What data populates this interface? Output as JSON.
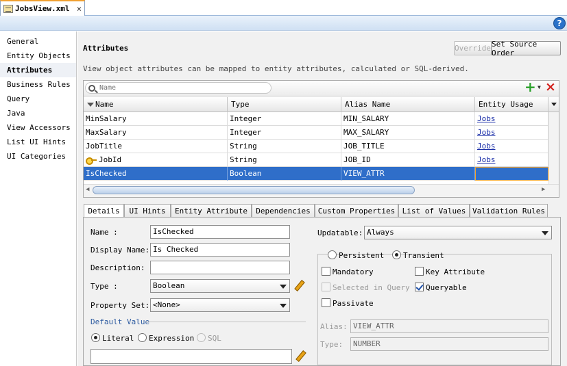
{
  "file_tab": {
    "label": "JobsView.xml",
    "close": "×"
  },
  "help": {
    "label": "?"
  },
  "nav": {
    "items": [
      {
        "label": "General",
        "active": false
      },
      {
        "label": "Entity Objects",
        "active": false
      },
      {
        "label": "Attributes",
        "active": true
      },
      {
        "label": "Business Rules",
        "active": false
      },
      {
        "label": "Query",
        "active": false
      },
      {
        "label": "Java",
        "active": false
      },
      {
        "label": "View Accessors",
        "active": false
      },
      {
        "label": "List UI Hints",
        "active": false
      },
      {
        "label": "UI Categories",
        "active": false
      }
    ]
  },
  "attributes": {
    "title": "Attributes",
    "override_label": "Override",
    "set_source_order_label": "Set Source Order",
    "description": "View object attributes can be mapped to entity attributes, calculated or SQL-derived.",
    "search_placeholder": "Name",
    "add_icon": "+",
    "delete_icon": "×",
    "columns": [
      "Name",
      "Type",
      "Alias Name",
      "Entity Usage"
    ],
    "rows": [
      {
        "name": "MinSalary",
        "type": "Integer",
        "alias": "MIN_SALARY",
        "usage": "Jobs",
        "key": false
      },
      {
        "name": "MaxSalary",
        "type": "Integer",
        "alias": "MAX_SALARY",
        "usage": "Jobs",
        "key": false
      },
      {
        "name": "JobTitle",
        "type": "String",
        "alias": "JOB_TITLE",
        "usage": "Jobs",
        "key": false
      },
      {
        "name": "JobId",
        "type": "String",
        "alias": "JOB_ID",
        "usage": "Jobs",
        "key": true
      },
      {
        "name": "IsChecked",
        "type": "Boolean",
        "alias": "VIEW_ATTR",
        "usage": "",
        "key": false
      }
    ],
    "selected_row": 4
  },
  "detail_tabs": [
    "Details",
    "UI Hints",
    "Entity Attribute",
    "Dependencies",
    "Custom Properties",
    "List of Values",
    "Validation Rules"
  ],
  "details": {
    "name_label": "Name :",
    "name_value": "IsChecked",
    "display_name_label": "Display Name:",
    "display_name_value": "Is Checked",
    "description_label": "Description:",
    "description_value": "",
    "type_label": "Type :",
    "type_value": "Boolean",
    "property_set_label": "Property Set:",
    "property_set_value": "<None>",
    "default_value_label": "Default Value",
    "literal_label": "Literal",
    "expression_label": "Expression",
    "sql_label": "SQL",
    "default_value_value": "",
    "updatable_label": "Updatable:",
    "updatable_value": "Always",
    "persistent_label": "Persistent",
    "transient_label": "Transient",
    "mandatory_label": "Mandatory",
    "key_attribute_label": "Key Attribute",
    "selected_in_query_label": "Selected in Query",
    "queryable_label": "Queryable",
    "passivate_label": "Passivate",
    "alias_label": "Alias:",
    "alias_value": "VIEW_ATTR",
    "dtype_label": "Type:",
    "dtype_value": "NUMBER"
  },
  "colors": {
    "selection": "#2f6ec9",
    "link": "#1a2ea8",
    "add": "#2aa02a",
    "delete": "#d2231f"
  }
}
